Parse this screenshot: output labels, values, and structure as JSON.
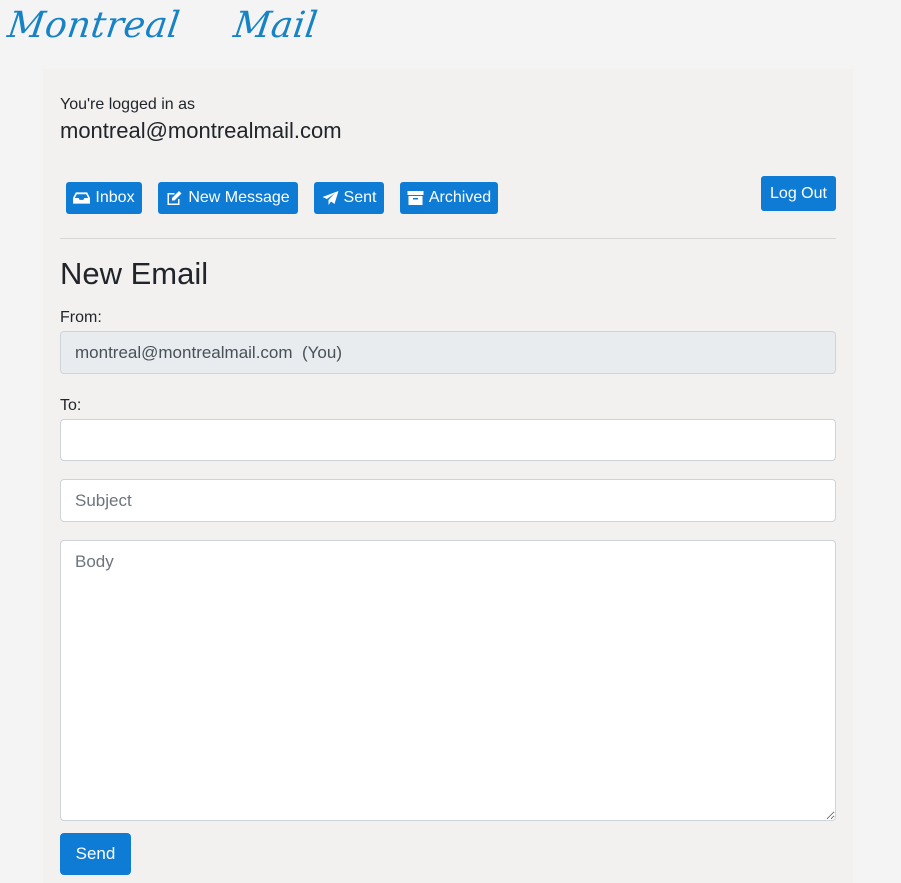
{
  "brand": {
    "name_part1": "Montreal",
    "name_part2": "Mail",
    "color": "#1683c7"
  },
  "session": {
    "logged_in_label": "You're logged in as",
    "user_email": "montreal@montrealmail.com"
  },
  "nav": {
    "inbox_label": "Inbox",
    "new_message_label": "New Message",
    "sent_label": "Sent",
    "archived_label": "Archived",
    "logout_label": "Log Out",
    "button_color": "#0e7bd4"
  },
  "compose": {
    "heading": "New Email",
    "from_label": "From:",
    "from_value": "montreal@montrealmail.com  (You)",
    "to_label": "To:",
    "to_value": "",
    "subject_placeholder": "Subject",
    "subject_value": "",
    "body_placeholder": "Body",
    "body_value": "",
    "send_label": "Send"
  }
}
